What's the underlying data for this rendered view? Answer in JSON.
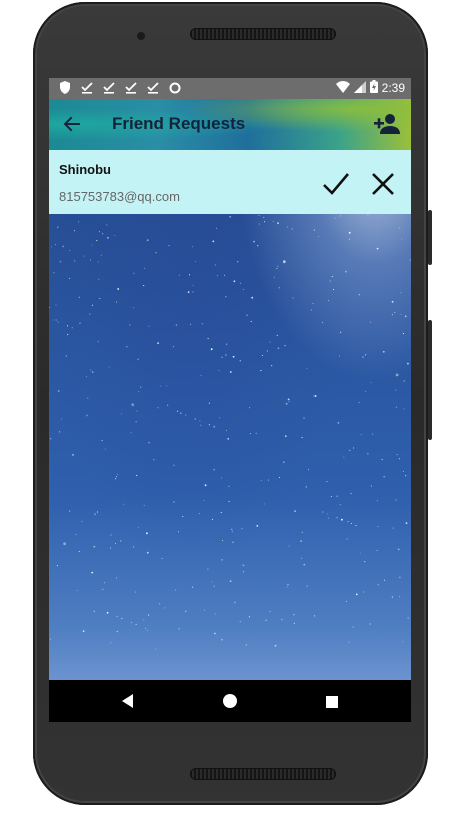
{
  "status_bar": {
    "time": "2:39",
    "left_icons": [
      "shield-icon",
      "check-download-icon",
      "check-download-icon",
      "check-download-icon",
      "check-download-icon",
      "circle-icon"
    ],
    "right_icons": [
      "wifi-icon",
      "signal-icon",
      "battery-charging-icon"
    ]
  },
  "toolbar": {
    "title": "Friend Requests",
    "back_icon": "arrow-left-icon",
    "action_icon": "person-add-icon"
  },
  "requests": [
    {
      "name": "Shinobu",
      "email": "815753783@qq.com",
      "accept_icon": "check-icon",
      "reject_icon": "close-icon"
    }
  ],
  "nav_bar": {
    "icons": [
      "back-triangle-icon",
      "home-circle-icon",
      "recents-square-icon"
    ]
  },
  "colors": {
    "row_background": "#c4f3f6",
    "status_bar": "#6d6d6d",
    "nav_bar": "#000000",
    "title_color": "#15233a"
  }
}
